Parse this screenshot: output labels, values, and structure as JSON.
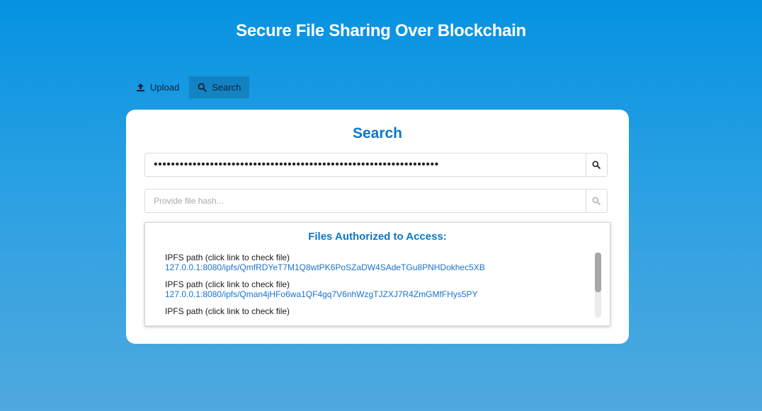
{
  "app": {
    "title": "Secure File Sharing Over Blockchain"
  },
  "tabs": [
    {
      "label": "Upload",
      "icon": "upload-icon",
      "active": false
    },
    {
      "label": "Search",
      "icon": "search-icon",
      "active": true
    }
  ],
  "card": {
    "title": "Search",
    "password_field": {
      "value": "••••••••••••••••••••••••••••••••••••••••••••••••••••••••••••••••••",
      "icon": "search-icon"
    },
    "hash_field": {
      "value": "",
      "placeholder": "Provide file hash...",
      "icon": "search-icon"
    }
  },
  "files": {
    "heading": "Files Authorized to Access:",
    "items": [
      {
        "label": "IPFS path (click link to check file)",
        "link": "127.0.0.1:8080/ipfs/QmfRDYeT7M1Q8wtPK6PoSZaDW4SAdeTGu8PNHDokhec5XB"
      },
      {
        "label": "IPFS path (click link to check file)",
        "link": "127.0.0.1:8080/ipfs/Qman4jHFo6wa1QF4gq7V6nhWzgTJZXJ7R4ZmGMfFHys5PY"
      },
      {
        "label": "IPFS path (click link to check file)",
        "link": ""
      }
    ],
    "scroll_position": 0
  },
  "colors": {
    "accent": "#0b78c8",
    "link": "#1a73c9",
    "background_top": "#0592e2",
    "background_bottom": "#4fa9de"
  }
}
